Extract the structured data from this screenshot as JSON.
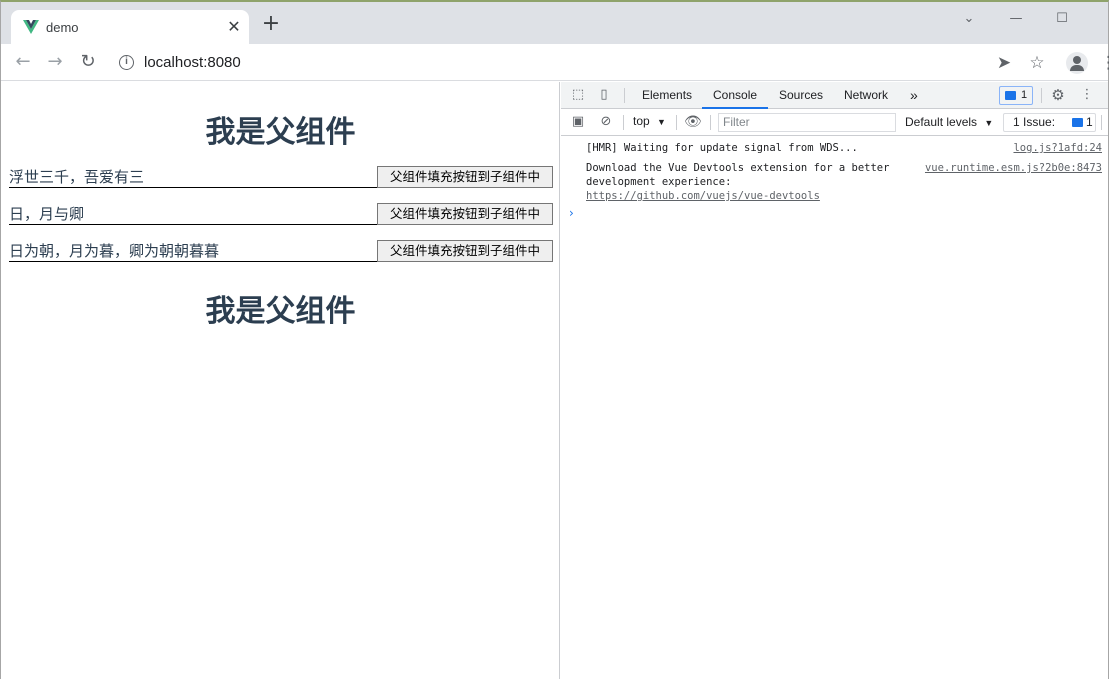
{
  "browser": {
    "tab_title": "demo",
    "tab_close": "✕",
    "new_tab": "+",
    "url": "localhost:8080",
    "icons": [
      "vue-logo-icon",
      "back-icon",
      "forward-icon",
      "reload-icon",
      "info-icon",
      "send-icon",
      "star-icon",
      "profile-icon",
      "more-icon",
      "minimize-icon",
      "maximize-icon",
      "tab-search-icon"
    ]
  },
  "page": {
    "heading_top": "我是父组件",
    "heading_bottom": "我是父组件",
    "rows": [
      {
        "text": "浮世三千，吾爱有三",
        "button": "父组件填充按钮到子组件中"
      },
      {
        "text": "日，月与卿",
        "button": "父组件填充按钮到子组件中"
      },
      {
        "text": "日为朝，月为暮，卿为朝朝暮暮",
        "button": "父组件填充按钮到子组件中"
      }
    ],
    "heading_color": "#2c3e50"
  },
  "devtools": {
    "tabs": [
      "Elements",
      "Console",
      "Sources",
      "Network"
    ],
    "active_tab": "Console",
    "more_tabs": "»",
    "message_badge_count": "1",
    "context": "top",
    "filter_placeholder": "Filter",
    "levels": "Default levels",
    "issues_label": "1 Issue:",
    "issues_count": "1",
    "console_messages": [
      {
        "text": "[HMR] Waiting for update signal from WDS...",
        "source": "log.js?1afd:24"
      },
      {
        "text_line1": "Download the Vue Devtools extension for a better",
        "text_line2": "development experience:",
        "link": "https://github.com/vuejs/vue-devtools",
        "source": "vue.runtime.esm.js?2b0e:8473"
      }
    ],
    "prompt": "›",
    "accent_color": "#1a73e8"
  }
}
